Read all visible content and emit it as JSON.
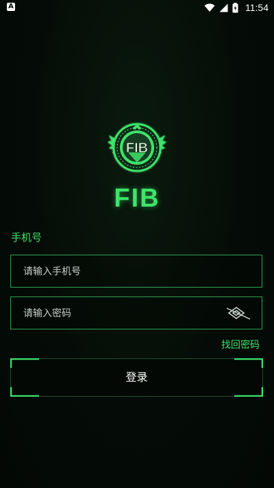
{
  "status_bar": {
    "left_icon": "a-notification-icon",
    "left_icon_text": "A",
    "icons": [
      "wifi-icon",
      "signal-icon",
      "battery-icon"
    ],
    "time": "11:54"
  },
  "brand": {
    "logo_icon": "fib-emblem-icon",
    "logo_text": "FIB",
    "title": "FIB"
  },
  "form": {
    "phone_label": "手机号",
    "phone_placeholder": "请输入手机号",
    "password_placeholder": "请输入密码",
    "password_toggle_icon": "eye-hidden-icon",
    "forgot_password": "找回密码",
    "login_button": "登录"
  },
  "colors": {
    "accent": "#3ee36a",
    "border": "#2fa352",
    "background": "#050c07",
    "text": "#ffffff"
  }
}
